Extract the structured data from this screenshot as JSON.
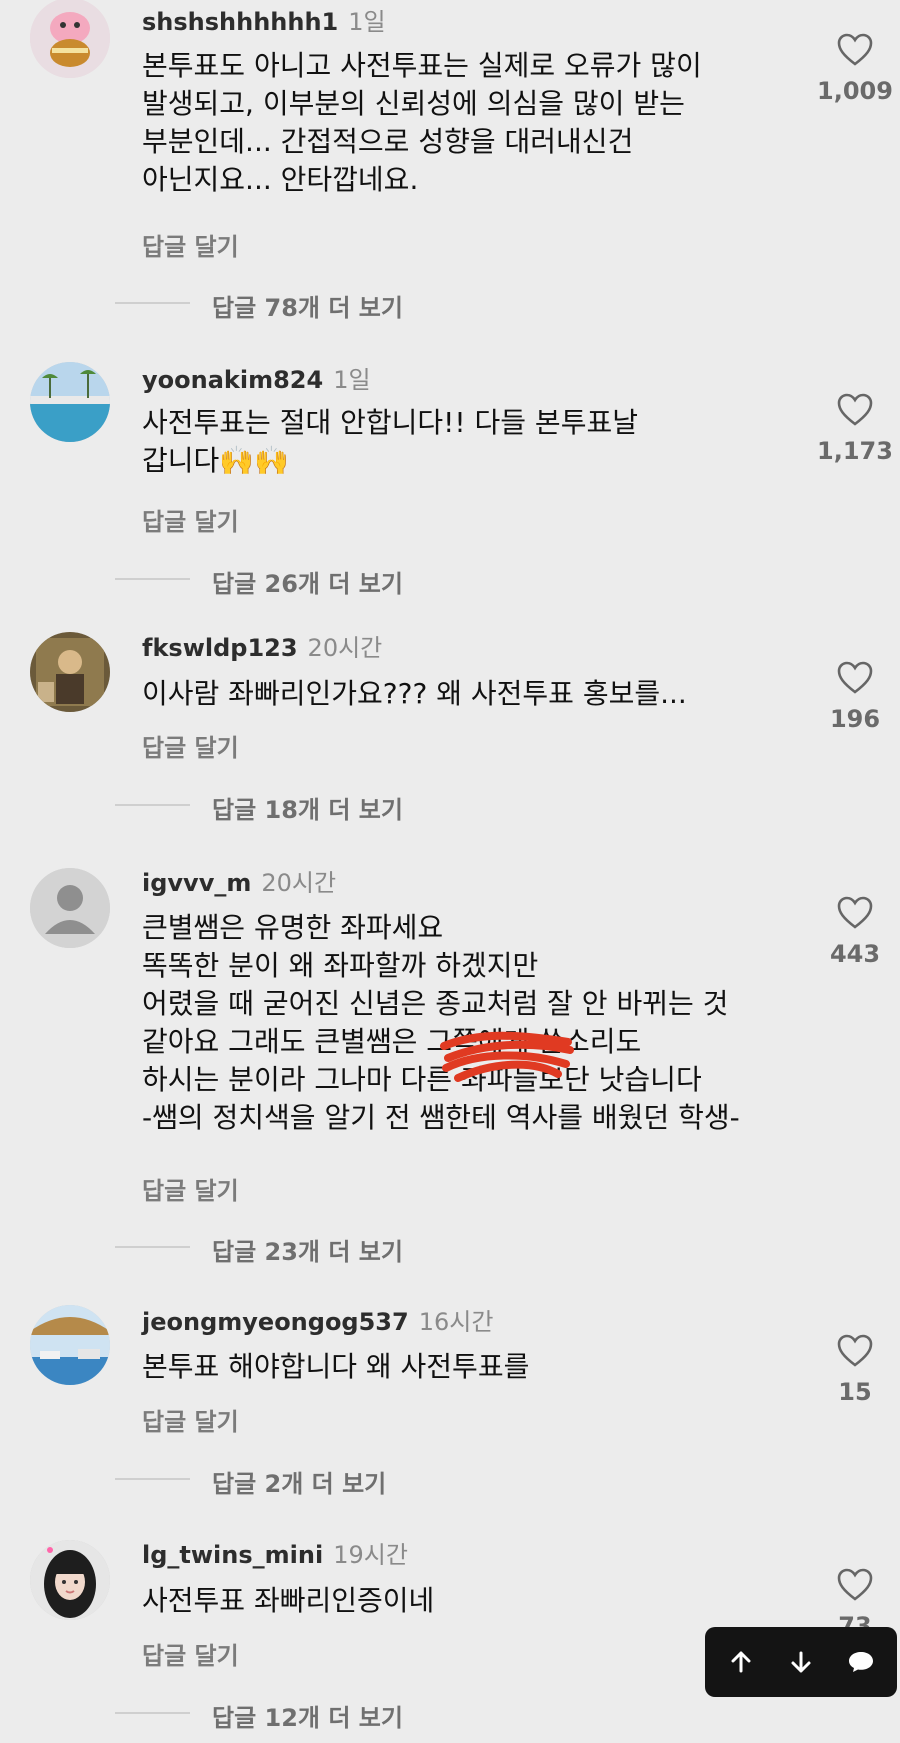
{
  "comments": [
    {
      "username": "shshshhhhhh1",
      "time": "1일",
      "text": "본투표도 아니고 사전투표는 실제로 오류가 많이\n발생되고, 이부분의 신뢰성에 의심을 많이 받는\n부분인데... 간접적으로 성향을 대러내신건\n아닌지요... 안타깝네요.",
      "reply_label": "답글 달기",
      "likes": "1,009",
      "more_replies": "답글 78개 더 보기",
      "avatar_icon": "pink-cartoon-avatar-icon"
    },
    {
      "username": "yoonakim824",
      "time": "1일",
      "text": "사전투표는 절대 안합니다!! 다들 본투표날\n갑니다🙌🙌",
      "reply_label": "답글 달기",
      "likes": "1,173",
      "more_replies": "답글 26개 더 보기",
      "avatar_icon": "pool-photo-avatar-icon"
    },
    {
      "username": "fkswldp123",
      "time": "20시간",
      "text": "이사람 좌빠리인가요??? 왜 사전투표 홍보를...",
      "reply_label": "답글 달기",
      "likes": "196",
      "more_replies": "답글 18개 더 보기",
      "avatar_icon": "painting-avatar-icon"
    },
    {
      "username": "igvvv_m",
      "time": "20시간",
      "text": "큰별쌤은 유명한 좌파세요\n똑똑한 분이 왜 좌파할까 하겠지만\n어렸을 때 굳어진 신념은 종교처럼 잘 안 바뀌는 것\n같아요 그래도 큰별쌤은 그쪽에게 쓴소리도\n하시는 분이라 그나마 다른 좌파들보단 낫습니다\n-쌤의 정치색을 알기 전 쌤한테 역사를 배웠던 학생-",
      "reply_label": "답글 달기",
      "likes": "443",
      "more_replies": "답글 23개 더 보기",
      "avatar_icon": "default-user-avatar-icon"
    },
    {
      "username": "jeongmyeongog537",
      "time": "16시간",
      "text": "본투표 해야합니다  왜 사전투표를",
      "reply_label": "답글 달기",
      "likes": "15",
      "more_replies": "답글 2개 더 보기",
      "avatar_icon": "beach-umbrella-avatar-icon"
    },
    {
      "username": "lg_twins_mini",
      "time": "19시간",
      "text": "사전투표 좌빠리인증이네",
      "reply_label": "답글 달기",
      "likes": "73",
      "more_replies": "답글 12개 더 보기",
      "avatar_icon": "girl-portrait-avatar-icon"
    }
  ],
  "nav": {
    "up_icon": "arrow-up-icon",
    "down_icon": "arrow-down-icon",
    "comment_icon": "speech-bubble-icon"
  },
  "colors": {
    "background": "#ececec",
    "text": "#111111",
    "muted": "#7b7b7b",
    "redaction": "#e03a22"
  }
}
